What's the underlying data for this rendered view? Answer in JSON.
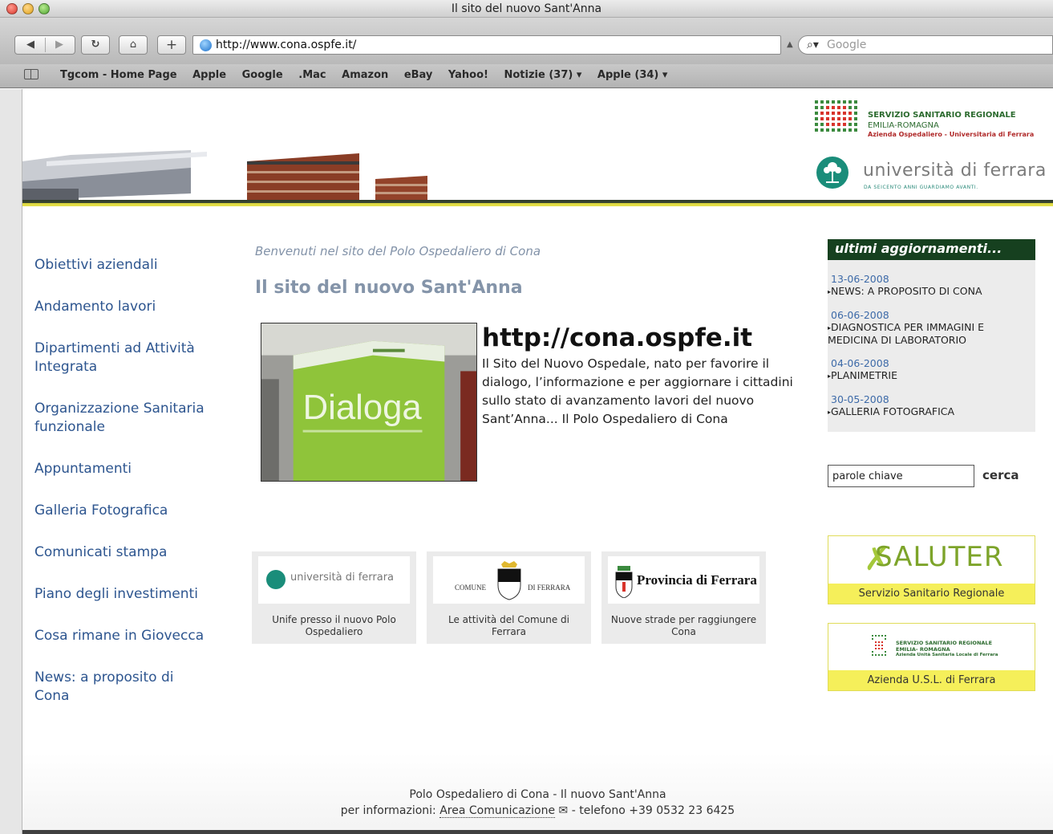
{
  "browser": {
    "window_title": "Il sito del nuovo Sant'Anna",
    "address": "http://www.cona.ospfe.it/",
    "search_placeholder": "Google",
    "bookmarks": [
      "Tgcom - Home Page",
      "Apple",
      "Google",
      ".Mac",
      "Amazon",
      "eBay",
      "Yahoo!",
      "Notizie (37) ▾",
      "Apple (34) ▾"
    ]
  },
  "header": {
    "ssr_line1": "SERVIZIO SANITARIO REGIONALE",
    "ssr_line2": "EMILIA-ROMAGNA",
    "ssr_line3": "Azienda Ospedaliero - Universitaria di Ferrara",
    "unife_name": "università di ferrara",
    "unife_motto": "DA SEICENTO ANNI GUARDIAMO AVANTI."
  },
  "nav": [
    "Obiettivi aziendali",
    "Andamento lavori",
    "Dipartimenti ad Attività Integrata",
    "Organizzazione Sanitaria funzionale",
    "Appuntamenti",
    "Galleria Fotografica",
    "Comunicati stampa",
    "Piano degli investimenti",
    "Cosa rimane in Giovecca",
    "News: a proposito di Cona"
  ],
  "main": {
    "welcome": "Benvenuti nel sito del Polo Ospedaliero di Cona",
    "title": "Il sito del nuovo Sant'Anna",
    "photo_text": "Dialoga",
    "url": "http://cona.ospfe.it",
    "description": "Il Sito del Nuovo Ospedale, nato per favorire il dialogo, l’informazione e per aggiornare i cittadini sullo stato di avanzamento lavori del nuovo Sant’Anna... Il Polo Ospedaliero di Cona"
  },
  "tiles": [
    {
      "logo": "università di ferrara",
      "caption": "Unife presso il nuovo Polo Ospedaliero"
    },
    {
      "logo_left": "COMUNE",
      "logo_right": "DI FERRARA",
      "caption": "Le attività del Comune di Ferrara"
    },
    {
      "logo": "Provincia di Ferrara",
      "caption": "Nuove strade per raggiungere Cona"
    }
  ],
  "updates": {
    "heading": "ultimi aggiornamenti...",
    "items": [
      {
        "date": "13-06-2008",
        "title": "NEWS: A PROPOSITO DI CONA"
      },
      {
        "date": "06-06-2008",
        "title": "DIAGNOSTICA PER IMMAGINI E MEDICINA DI LABORATORIO"
      },
      {
        "date": "04-06-2008",
        "title": "PLANIMETRIE"
      },
      {
        "date": "30-05-2008",
        "title": "GALLERIA FOTOGRAFICA"
      }
    ]
  },
  "search": {
    "value": "parole chiave",
    "button": "cerca"
  },
  "partners": {
    "saluter_logo": "SALUTER",
    "saluter_caption": "Servizio Sanitario Regionale",
    "usl_line1": "SERVIZIO SANITARIO REGIONALE",
    "usl_line2": "EMILIA- ROMAGNA",
    "usl_line3": "Azienda Unità Sanitaria Locale di Ferrara",
    "usl_caption": "Azienda U.S.L. di Ferrara"
  },
  "footer": {
    "line1": "Polo Ospedaliero di Cona - Il nuovo Sant'Anna",
    "prefix": "per informazioni:",
    "link": "Area Comunicazione",
    "suffix": "- telefono +39 0532 23 6425"
  },
  "colors": {
    "nav_link": "#2d558f",
    "updates_header": "#16401f",
    "partner_caption": "#f5ef5a",
    "header_rule_dark": "#2f3b2a",
    "header_rule_yellow": "#d9d43a"
  }
}
